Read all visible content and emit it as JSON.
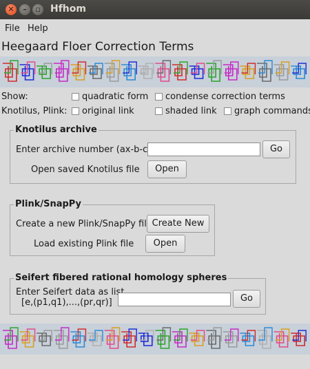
{
  "window": {
    "title": "Hfhom"
  },
  "menu": {
    "items": [
      "File",
      "Help"
    ]
  },
  "heading": "Heegaard Floer Correction Terms",
  "show": {
    "label": "Show:",
    "quadratic_form": "quadratic form",
    "condense": "condense correction terms"
  },
  "knotilus_plink": {
    "label": "Knotilus, Plink:",
    "original_link": "original link",
    "shaded_link": "shaded link",
    "graph_commands": "graph commands"
  },
  "knotilus_archive": {
    "title": "Knotilus archive",
    "enter_label": "Enter archive number (ax-b-c).",
    "input_value": "",
    "go_label": "Go",
    "open_label": "Open saved Knotilus file",
    "open_button": "Open"
  },
  "plink": {
    "title": "Plink/SnapPy",
    "create_label": "Create a new Plink/SnapPy file.",
    "create_button": "Create New",
    "load_label": "Load existing Plink file",
    "open_button": "Open"
  },
  "seifert": {
    "title": "Seifert fibered rational homology spheres",
    "enter_label_line1": "Enter Seifert data as list",
    "enter_label_line2": "[e,(p1,q1),...,(pr,qr)]",
    "input_value": "",
    "go_label": "Go"
  },
  "colors": {
    "knot_strip": "#c8d0da",
    "knots": [
      "#d12a2a",
      "#1e2bd6",
      "#2aa52a",
      "#c52ac5",
      "#d8a020",
      "#6a6a6a",
      "#9a9a9a",
      "#2a8ad6",
      "#b0b0b0",
      "#e04a8a"
    ]
  }
}
